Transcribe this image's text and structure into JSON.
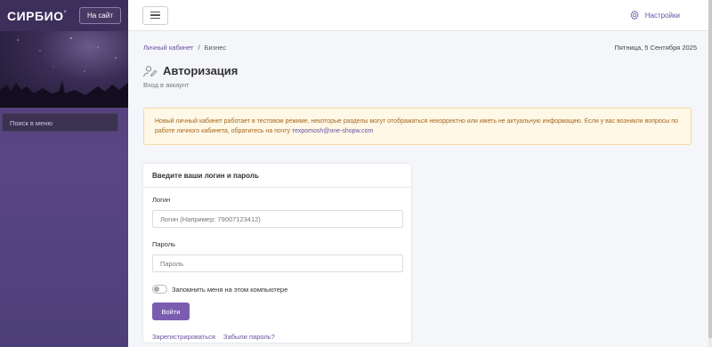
{
  "sidebar": {
    "logo": "СИРБИО",
    "logo_mark": "°",
    "site_button": "На сайт",
    "search_placeholder": "Поиск в меню"
  },
  "topbar": {
    "menu_icon": "hamburger-icon",
    "settings_icon": "gear-icon",
    "settings_label": "Настройки"
  },
  "breadcrumb": {
    "link": "Личный кабинет",
    "separator": "/",
    "current": "Бизнес"
  },
  "date": "Пятница, 5 Сентября 2025",
  "page": {
    "icon": "user-edit-icon",
    "title": "Авторизация",
    "subtitle": "Вход в аккаунт"
  },
  "alert": {
    "text": "Новый личный кабинет работает в тестовом режиме, некоторые разделы могут отображаться некорректно или иметь не актуальную информацию. Если у вас возникли вопросы по работе личного кабинета, обратитесь на почту",
    "email": "техpomosh@one-shopw.com"
  },
  "login_card": {
    "header": "Введите ваши логин и пароль",
    "login_label": "Логин",
    "login_placeholder": "Логин (Например: 79007123412)",
    "password_label": "Пароль",
    "password_placeholder": "Пароль",
    "remember_label": "Запомнить меня на этом компьютере",
    "remember_checked": false,
    "submit_label": "Войти",
    "register_link": "Зарегистрироваться",
    "forgot_link": "Забыли пароль?"
  },
  "colors": {
    "accent": "#7b5db0",
    "link": "#6a4fa0",
    "sidebar": "#4a3b6e",
    "alert_bg": "#fff8e6",
    "alert_text": "#a5661e"
  }
}
